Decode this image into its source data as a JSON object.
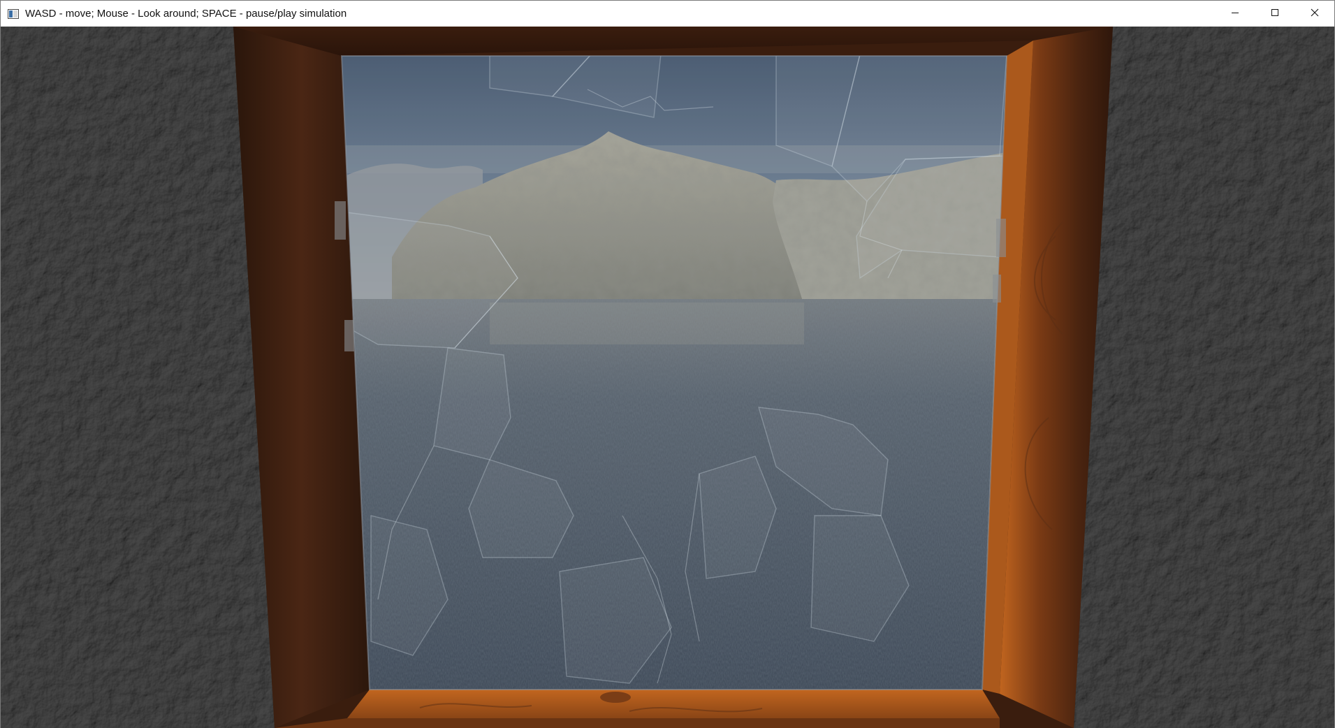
{
  "window": {
    "title": "WASD - move; Mouse - Look around; SPACE - pause/play simulation",
    "controls": {
      "minimize_icon": "minimize-icon",
      "maximize_icon": "maximize-icon",
      "close_icon": "close-icon"
    }
  },
  "scene": {
    "description_icons": [
      "app-icon"
    ],
    "colors": {
      "wall": "#353535",
      "frame_dark": "#3a1f10",
      "frame_light": "#b8601e",
      "sky": "#5a6b82",
      "water": "#2f3b4a",
      "mountain": "#8f8d80"
    }
  }
}
